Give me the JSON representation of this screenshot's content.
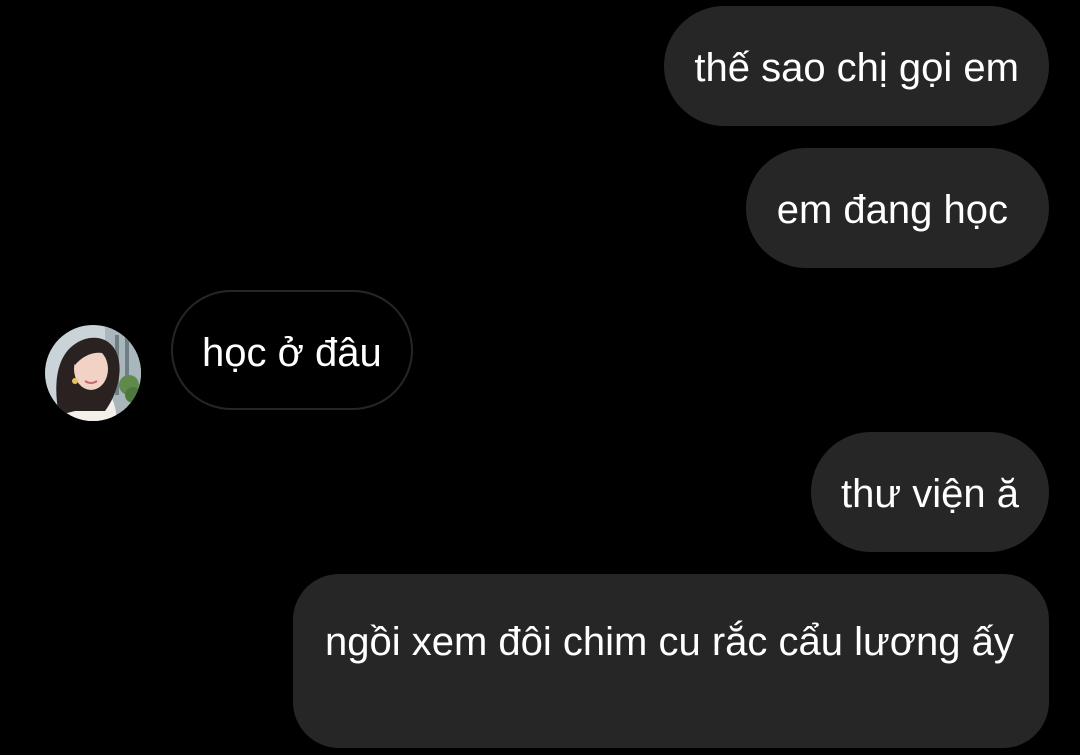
{
  "conversation": {
    "avatar_icon": "profile-photo-avatar",
    "colors": {
      "background": "#000000",
      "sent_bubble": "#262626",
      "received_bubble_border": "#262626",
      "text": "#ffffff"
    },
    "messages": [
      {
        "direction": "sent",
        "text": "thế sao chị gọi em"
      },
      {
        "direction": "sent",
        "text": "em đang học"
      },
      {
        "direction": "received",
        "text": "học ở đâu"
      },
      {
        "direction": "sent",
        "text": "thư viện ă"
      },
      {
        "direction": "sent",
        "text": "ngồi xem đôi chim cu rắc cẩu lương ấy"
      }
    ]
  }
}
